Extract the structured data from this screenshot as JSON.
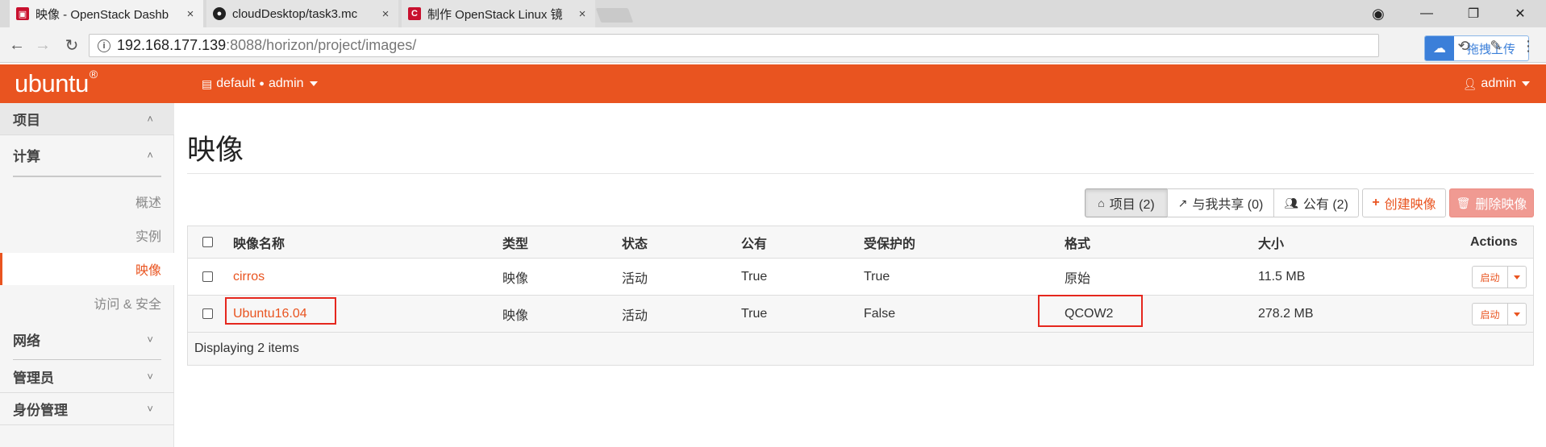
{
  "browser": {
    "tabs": [
      {
        "title": "映像 - OpenStack Dashb",
        "favicon": "openstack-favicon",
        "close": "×"
      },
      {
        "title": "cloudDesktop/task3.mc",
        "favicon": "github-icon",
        "close": "×"
      },
      {
        "title": "制作 OpenStack Linux 镜",
        "favicon": "csdn-icon",
        "close": "×"
      }
    ],
    "window_controls": {
      "minimize": "—",
      "restore": "❐",
      "close": "✕"
    },
    "url_host": "192.168.177.139",
    "url_path": ":8088/horizon/project/images/",
    "extension_label": "拖拽上传"
  },
  "header": {
    "brand": "ubuntu",
    "brand_mark": "®",
    "context_domain": "default",
    "context_project": "admin",
    "user": "admin"
  },
  "sidebar": {
    "project": "项目",
    "compute": "计算",
    "compute_items": [
      "概述",
      "实例",
      "映像",
      "访问 & 安全"
    ],
    "active_item": "映像",
    "network": "网络",
    "admin": "管理员",
    "identity": "身份管理"
  },
  "page": {
    "title": "映像"
  },
  "filters": {
    "project": "项目 (2)",
    "shared": "与我共享 (0)",
    "public": "公有 (2)"
  },
  "actions": {
    "create": "创建映像",
    "delete": "删除映像"
  },
  "table": {
    "columns": [
      "映像名称",
      "类型",
      "状态",
      "公有",
      "受保护的",
      "格式",
      "大小",
      "Actions"
    ],
    "rows": [
      {
        "name": "cirros",
        "type": "映像",
        "status": "活动",
        "public": "True",
        "protected": "True",
        "format": "原始",
        "size": "11.5 MB",
        "action": "启动"
      },
      {
        "name": "Ubuntu16.04",
        "type": "映像",
        "status": "活动",
        "public": "True",
        "protected": "False",
        "format": "QCOW2",
        "size": "278.2 MB",
        "action": "启动"
      }
    ],
    "footer": "Displaying 2 items"
  },
  "colors": {
    "accent": "#e95420",
    "highlight_box": "#e5271e"
  }
}
